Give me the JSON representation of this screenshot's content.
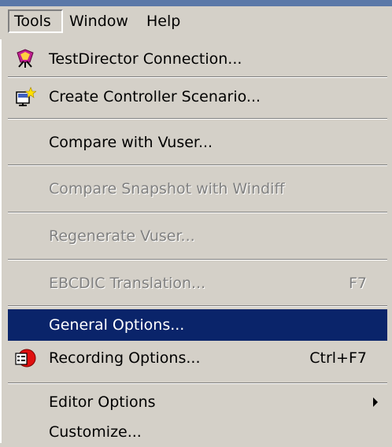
{
  "menubar": {
    "tools": "Tools",
    "window": "Window",
    "help": "Help"
  },
  "menu": {
    "items": [
      {
        "label": "TestDirector Connection...",
        "icon": "testdirector-icon",
        "enabled": true
      },
      {
        "label": "Create Controller Scenario...",
        "icon": "controller-scenario-icon",
        "enabled": true
      },
      {
        "label": "Compare with Vuser...",
        "enabled": true
      },
      {
        "label": "Compare Snapshot with Windiff",
        "enabled": false
      },
      {
        "label": "Regenerate Vuser...",
        "enabled": false
      },
      {
        "label": "EBCDIC Translation...",
        "shortcut": "F7",
        "enabled": false
      },
      {
        "label": "General Options...",
        "enabled": true,
        "highlighted": true
      },
      {
        "label": "Recording Options...",
        "shortcut": "Ctrl+F7",
        "icon": "recording-options-icon",
        "enabled": true
      },
      {
        "label": "Editor Options",
        "enabled": true,
        "submenu": true
      },
      {
        "label": "Customize...",
        "enabled": true
      }
    ]
  },
  "colors": {
    "menu_bg": "#d4d0c8",
    "highlight_bg": "#0a246a",
    "highlight_text": "#ffffff",
    "disabled_text": "#808080"
  }
}
